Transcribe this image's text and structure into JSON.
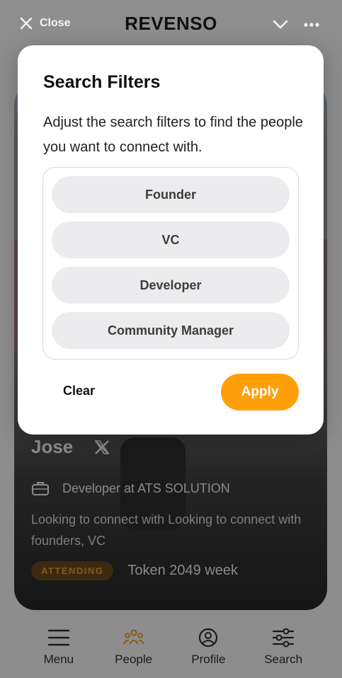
{
  "header": {
    "close_label": "Close",
    "title": "REVENSO"
  },
  "profile": {
    "name": "Jose",
    "role": "Developer at ATS SOLUTION",
    "bio": "Looking to connect with Looking to connect with founders, VC",
    "badge": "ATTENDING",
    "token": "Token 2049 week"
  },
  "modal": {
    "title": "Search Filters",
    "description": "Adjust the search filters to find the people you want to connect with.",
    "options": [
      {
        "label": "Founder"
      },
      {
        "label": "VC"
      },
      {
        "label": "Developer"
      },
      {
        "label": "Community Manager"
      }
    ],
    "clear_label": "Clear",
    "apply_label": "Apply"
  },
  "nav": {
    "items": [
      {
        "label": "Menu",
        "icon": "hamburger-icon"
      },
      {
        "label": "People",
        "icon": "people-icon"
      },
      {
        "label": "Profile",
        "icon": "user-circle-icon"
      },
      {
        "label": "Search",
        "icon": "sliders-icon"
      }
    ]
  },
  "colors": {
    "accent": "#ff9f0a",
    "backdrop": "#8d8d8d",
    "pill": "#ececee"
  }
}
